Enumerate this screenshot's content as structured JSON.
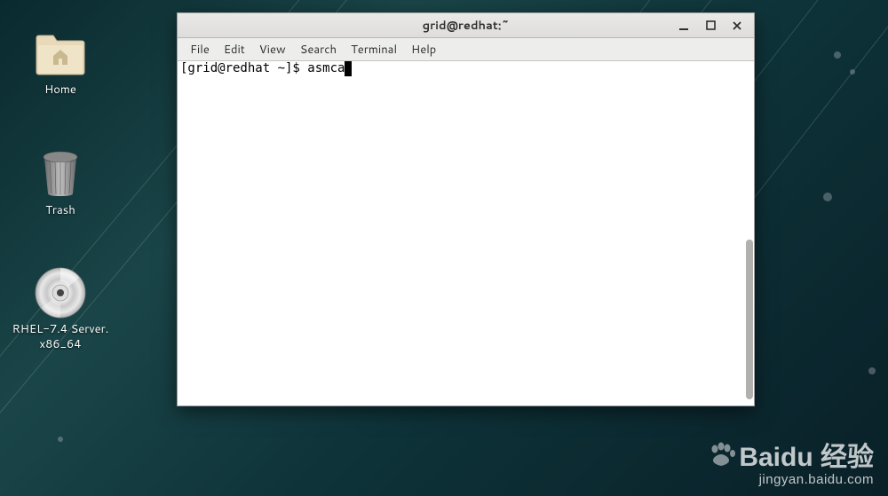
{
  "desktop": {
    "icons": [
      {
        "label": "Home"
      },
      {
        "label": "Trash"
      },
      {
        "label": "RHEL-7.4 Server.\nx86_64"
      }
    ]
  },
  "terminal": {
    "title": "grid@redhat:~",
    "menu": {
      "file": "File",
      "edit": "Edit",
      "view": "View",
      "search": "Search",
      "terminal": "Terminal",
      "help": "Help"
    },
    "prompt": "[grid@redhat ~]$ ",
    "command": "asmca"
  },
  "watermark": {
    "main": "Baidu 经验",
    "sub": "jingyan.baidu.com"
  }
}
